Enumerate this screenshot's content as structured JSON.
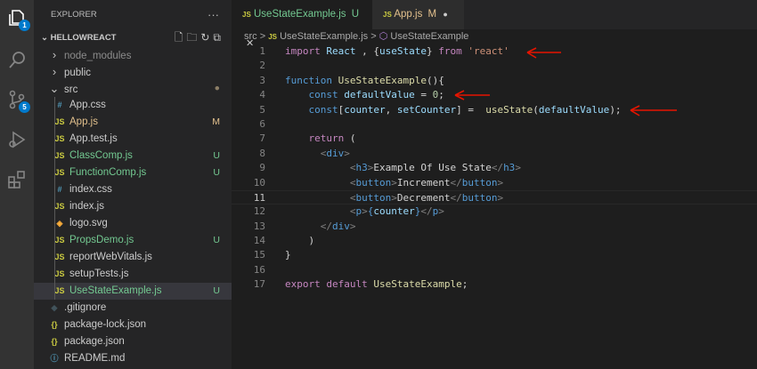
{
  "activity_bar": {
    "explorer_badge": "1",
    "scm_badge": "5"
  },
  "sidebar": {
    "title": "EXPLORER",
    "more": "···",
    "project": "HELLOWREACT",
    "items": [
      {
        "label": "node_modules",
        "type": "folder",
        "collapsed": true,
        "depth": 1,
        "color": "#8c8c8c"
      },
      {
        "label": "public",
        "type": "folder",
        "collapsed": true,
        "depth": 1,
        "color": "#cccccc"
      },
      {
        "label": "src",
        "type": "folder",
        "collapsed": false,
        "depth": 1,
        "color": "#cccccc",
        "status": "●"
      },
      {
        "label": "App.css",
        "type": "css",
        "depth": 2,
        "color": "#cccccc"
      },
      {
        "label": "App.js",
        "type": "js",
        "depth": 2,
        "color": "#e2c08d",
        "status": "M"
      },
      {
        "label": "App.test.js",
        "type": "js",
        "depth": 2,
        "color": "#cccccc"
      },
      {
        "label": "ClassComp.js",
        "type": "js",
        "depth": 2,
        "color": "#73c991",
        "status": "U"
      },
      {
        "label": "FunctionComp.js",
        "type": "js",
        "depth": 2,
        "color": "#73c991",
        "status": "U"
      },
      {
        "label": "index.css",
        "type": "css",
        "depth": 2,
        "color": "#cccccc"
      },
      {
        "label": "index.js",
        "type": "js",
        "depth": 2,
        "color": "#cccccc"
      },
      {
        "label": "logo.svg",
        "type": "svg",
        "depth": 2,
        "color": "#cccccc"
      },
      {
        "label": "PropsDemo.js",
        "type": "js",
        "depth": 2,
        "color": "#73c991",
        "status": "U"
      },
      {
        "label": "reportWebVitals.js",
        "type": "js",
        "depth": 2,
        "color": "#cccccc"
      },
      {
        "label": "setupTests.js",
        "type": "js",
        "depth": 2,
        "color": "#cccccc"
      },
      {
        "label": "UseStateExample.js",
        "type": "js",
        "depth": 2,
        "color": "#73c991",
        "status": "U",
        "selected": true
      },
      {
        "label": ".gitignore",
        "type": "git",
        "depth": 1,
        "color": "#cccccc"
      },
      {
        "label": "package-lock.json",
        "type": "json",
        "depth": 1,
        "color": "#cccccc"
      },
      {
        "label": "package.json",
        "type": "json",
        "depth": 1,
        "color": "#cccccc"
      },
      {
        "label": "README.md",
        "type": "md",
        "depth": 1,
        "color": "#cccccc"
      }
    ]
  },
  "tabs": [
    {
      "icon": "JS",
      "label": "UseStateExample.js",
      "status": "U",
      "close": "✕",
      "active": true
    },
    {
      "icon": "JS",
      "label": "App.js",
      "status": "M",
      "close": "●",
      "active": false
    }
  ],
  "breadcrumb": {
    "folder": "src",
    "sep": ">",
    "file": "UseStateExample.js",
    "symbol": "UseStateExample"
  },
  "code": {
    "current_line": 11,
    "lines": [
      [
        [
          "import",
          "kw"
        ],
        [
          " React ",
          "vr"
        ],
        [
          ", {",
          "tx"
        ],
        [
          "useState",
          "vr"
        ],
        [
          "} ",
          "tx"
        ],
        [
          "from",
          "kw"
        ],
        [
          " ",
          "tx"
        ],
        [
          "'react'",
          "str"
        ]
      ],
      [],
      [
        [
          "function",
          "bl"
        ],
        [
          " ",
          "tx"
        ],
        [
          "UseStateExample",
          "fn"
        ],
        [
          "(){",
          "tx"
        ]
      ],
      [
        [
          "    ",
          "tx"
        ],
        [
          "const",
          "bl"
        ],
        [
          " ",
          "tx"
        ],
        [
          "defaultValue",
          "vr"
        ],
        [
          " = ",
          "tx"
        ],
        [
          "0",
          "num"
        ],
        [
          ";",
          "tx"
        ]
      ],
      [
        [
          "    ",
          "tx"
        ],
        [
          "const",
          "bl"
        ],
        [
          "[",
          "tx"
        ],
        [
          "counter",
          "vr"
        ],
        [
          ", ",
          "tx"
        ],
        [
          "setCounter",
          "vr"
        ],
        [
          "] =  ",
          "tx"
        ],
        [
          "useState",
          "fn"
        ],
        [
          "(",
          "tx"
        ],
        [
          "defaultValue",
          "vr"
        ],
        [
          ");",
          "tx"
        ]
      ],
      [],
      [
        [
          "    ",
          "tx"
        ],
        [
          "return",
          "kw"
        ],
        [
          " (",
          "tx"
        ]
      ],
      [
        [
          "      ",
          "tx"
        ],
        [
          "<",
          "tg"
        ],
        [
          "div",
          "bl"
        ],
        [
          ">",
          "tg"
        ]
      ],
      [
        [
          "           ",
          "tx"
        ],
        [
          "<",
          "tg"
        ],
        [
          "h3",
          "bl"
        ],
        [
          ">",
          "tg"
        ],
        [
          "Example Of Use State",
          "tx"
        ],
        [
          "</",
          "tg"
        ],
        [
          "h3",
          "bl"
        ],
        [
          ">",
          "tg"
        ]
      ],
      [
        [
          "           ",
          "tx"
        ],
        [
          "<",
          "tg"
        ],
        [
          "button",
          "bl"
        ],
        [
          ">",
          "tg"
        ],
        [
          "Increment",
          "tx"
        ],
        [
          "</",
          "tg"
        ],
        [
          "button",
          "bl"
        ],
        [
          ">",
          "tg"
        ]
      ],
      [
        [
          "           ",
          "tx"
        ],
        [
          "<",
          "tg"
        ],
        [
          "button",
          "bl"
        ],
        [
          ">",
          "tg"
        ],
        [
          "Decrement",
          "tx"
        ],
        [
          "</",
          "tg"
        ],
        [
          "button",
          "bl"
        ],
        [
          ">",
          "tg"
        ]
      ],
      [
        [
          "           ",
          "tx"
        ],
        [
          "<",
          "tg"
        ],
        [
          "p",
          "bl"
        ],
        [
          ">",
          "tg"
        ],
        [
          "{",
          "bl"
        ],
        [
          "counter",
          "vr"
        ],
        [
          "}",
          "bl"
        ],
        [
          "</",
          "tg"
        ],
        [
          "p",
          "bl"
        ],
        [
          ">",
          "tg"
        ]
      ],
      [
        [
          "      ",
          "tx"
        ],
        [
          "</",
          "tg"
        ],
        [
          "div",
          "bl"
        ],
        [
          ">",
          "tg"
        ]
      ],
      [
        [
          "    ",
          "tx"
        ],
        [
          ")",
          "tx"
        ]
      ],
      [
        [
          "}",
          "tx"
        ]
      ],
      [],
      [
        [
          "export",
          "kw"
        ],
        [
          " ",
          "tx"
        ],
        [
          "default",
          "kw"
        ],
        [
          " ",
          "tx"
        ],
        [
          "UseStateExample",
          "fn"
        ],
        [
          ";",
          "tx"
        ]
      ]
    ]
  },
  "colors": {
    "accent": "#007acc",
    "annotation": "#e51400"
  }
}
